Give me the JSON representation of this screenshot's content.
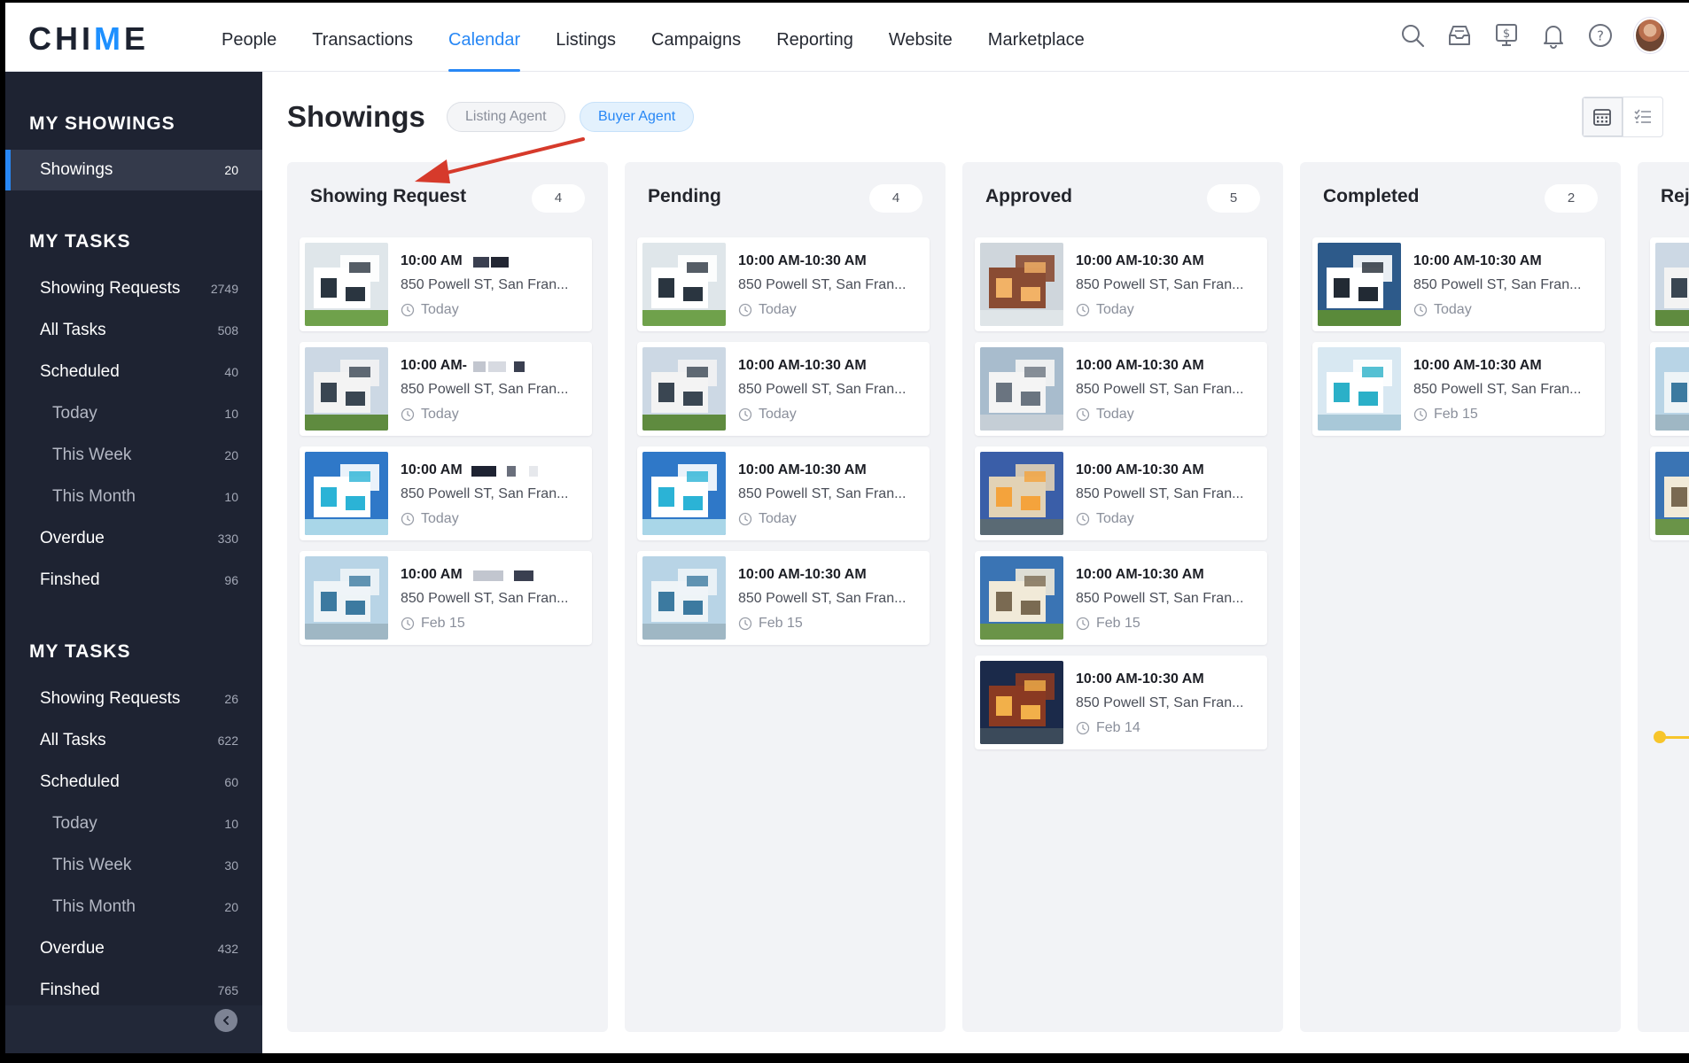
{
  "app": {
    "logo_text": "CHIME"
  },
  "nav": {
    "items": [
      "People",
      "Transactions",
      "Calendar",
      "Listings",
      "Campaigns",
      "Reporting",
      "Website",
      "Marketplace"
    ],
    "active": "Calendar",
    "icons": [
      "search-icon",
      "inbox-icon",
      "dollar-icon",
      "bell-icon",
      "help-icon"
    ]
  },
  "sidebar": {
    "my_showings": {
      "heading": "MY SHOWINGS",
      "items": [
        {
          "label": "Showings",
          "count": "20"
        }
      ]
    },
    "my_tasks_1": {
      "heading": "MY TASKS",
      "items": [
        {
          "label": "Showing Requests",
          "count": "2749"
        },
        {
          "label": "All Tasks",
          "count": "508"
        },
        {
          "label": "Scheduled",
          "count": "40"
        },
        {
          "label": "Today",
          "count": "10"
        },
        {
          "label": "This Week",
          "count": "20"
        },
        {
          "label": "This Month",
          "count": "10"
        },
        {
          "label": "Overdue",
          "count": "330"
        },
        {
          "label": "Finshed",
          "count": "96"
        }
      ]
    },
    "my_tasks_2": {
      "heading": "MY TASKS",
      "items": [
        {
          "label": "Showing Requests",
          "count": "26"
        },
        {
          "label": "All Tasks",
          "count": "622"
        },
        {
          "label": "Scheduled",
          "count": "60"
        },
        {
          "label": "Today",
          "count": "10"
        },
        {
          "label": "This Week",
          "count": "30"
        },
        {
          "label": "This Month",
          "count": "20"
        },
        {
          "label": "Overdue",
          "count": "432"
        },
        {
          "label": "Finshed",
          "count": "765"
        }
      ]
    }
  },
  "page": {
    "title": "Showings",
    "filters": {
      "listing_agent": "Listing Agent",
      "buyer_agent": "Buyer Agent",
      "selected": "Buyer Agent"
    },
    "view_modes": [
      "calendar-grid-icon",
      "list-view-icon"
    ]
  },
  "columns": [
    {
      "title": "Showing Request",
      "count": "4",
      "cards": [
        {
          "time": "10:00 AM",
          "address": "850 Powell ST, San Fran...",
          "date": "Today"
        },
        {
          "time": "10:00 AM-",
          "address": "850 Powell ST, San Fran...",
          "date": "Today"
        },
        {
          "time": "10:00 AM",
          "address": "850 Powell ST, San Fran...",
          "date": "Today"
        },
        {
          "time": "10:00 AM",
          "address": "850 Powell ST, San Fran...",
          "date": "Feb 15"
        }
      ]
    },
    {
      "title": "Pending",
      "count": "4",
      "cards": [
        {
          "time": "10:00 AM-10:30 AM",
          "address": "850 Powell ST, San Fran...",
          "date": "Today"
        },
        {
          "time": "10:00 AM-10:30 AM",
          "address": "850 Powell ST, San Fran...",
          "date": "Today"
        },
        {
          "time": "10:00 AM-10:30 AM",
          "address": "850 Powell ST, San Fran...",
          "date": "Today"
        },
        {
          "time": "10:00 AM-10:30 AM",
          "address": "850 Powell ST, San Fran...",
          "date": "Feb 15"
        }
      ]
    },
    {
      "title": "Approved",
      "count": "5",
      "cards": [
        {
          "time": "10:00 AM-10:30 AM",
          "address": "850 Powell ST, San Fran...",
          "date": "Today"
        },
        {
          "time": "10:00 AM-10:30 AM",
          "address": "850 Powell ST, San Fran...",
          "date": "Today"
        },
        {
          "time": "10:00 AM-10:30 AM",
          "address": "850 Powell ST, San Fran...",
          "date": "Today"
        },
        {
          "time": "10:00 AM-10:30 AM",
          "address": "850 Powell ST, San Fran...",
          "date": "Feb 15"
        },
        {
          "time": "10:00 AM-10:30 AM",
          "address": "850 Powell ST, San Fran...",
          "date": "Feb 14"
        }
      ]
    },
    {
      "title": "Completed",
      "count": "2",
      "cards": [
        {
          "time": "10:00 AM-10:30 AM",
          "address": "850 Powell ST, San Fran...",
          "date": "Today"
        },
        {
          "time": "10:00 AM-10:30 AM",
          "address": "850 Powell ST, San Fran...",
          "date": "Feb 15"
        }
      ]
    },
    {
      "title": "Rej",
      "count": "",
      "cards": [
        {
          "time": "",
          "address": "",
          "date": ""
        },
        {
          "time": "",
          "address": "",
          "date": ""
        },
        {
          "time": "",
          "address": "",
          "date": ""
        }
      ]
    }
  ],
  "colors": {
    "accent": "#2787f5",
    "sidebar_bg": "#1e2332",
    "column_bg": "#f2f3f6",
    "annotation_arrow": "#d63a2b",
    "timeline": "#f7c52b"
  }
}
